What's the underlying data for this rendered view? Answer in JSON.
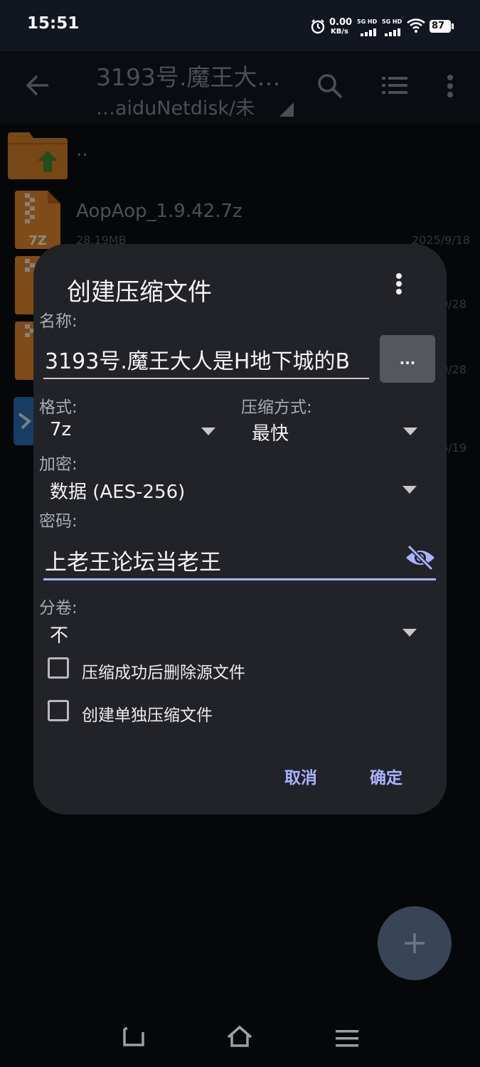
{
  "status": {
    "time": "15:51",
    "net_speed_value": "0.00",
    "net_speed_unit": "KB/s",
    "sim1": "5G HD",
    "sim2": "5G HD",
    "battery": "87"
  },
  "toolbar": {
    "title": "3193号.魔王大…",
    "path": "…aiduNetdisk/未"
  },
  "list": [
    {
      "name": "..",
      "meta": "",
      "date": "",
      "icon": "folder-up-icon"
    },
    {
      "name": "AopAop_1.9.42.7z",
      "meta": "28.19MB",
      "date": "2025/9/18",
      "icon": "archive-7z-icon"
    },
    {
      "name": "",
      "meta": "",
      "date": "0/28",
      "icon": "archive-7z-icon"
    },
    {
      "name": "",
      "meta": "",
      "date": "0/28",
      "icon": "archive-7z-icon"
    },
    {
      "name": "",
      "meta": "",
      "date": "6/19",
      "icon": "app-file-icon"
    }
  ],
  "dialog": {
    "title": "创建压缩文件",
    "name_label": "名称:",
    "name_value": "3193号.魔王大人是H地下城的B",
    "browse_label": "...",
    "format_label": "格式:",
    "format_value": "7z",
    "method_label": "压缩方式:",
    "method_value": "最快",
    "encrypt_label": "加密:",
    "encrypt_value": "数据 (AES-256)",
    "password_label": "密码:",
    "password_value": "上老王论坛当老王",
    "split_label": "分卷:",
    "split_value": "不",
    "delete_source_label": "压缩成功后删除源文件",
    "delete_source_checked": false,
    "separate_label": "创建单独压缩文件",
    "separate_checked": false,
    "cancel_label": "取消",
    "ok_label": "确定"
  },
  "colors": {
    "accent": "#aab3ff",
    "dialog_bg": "#222328",
    "archive_orange": "#e8892c"
  }
}
